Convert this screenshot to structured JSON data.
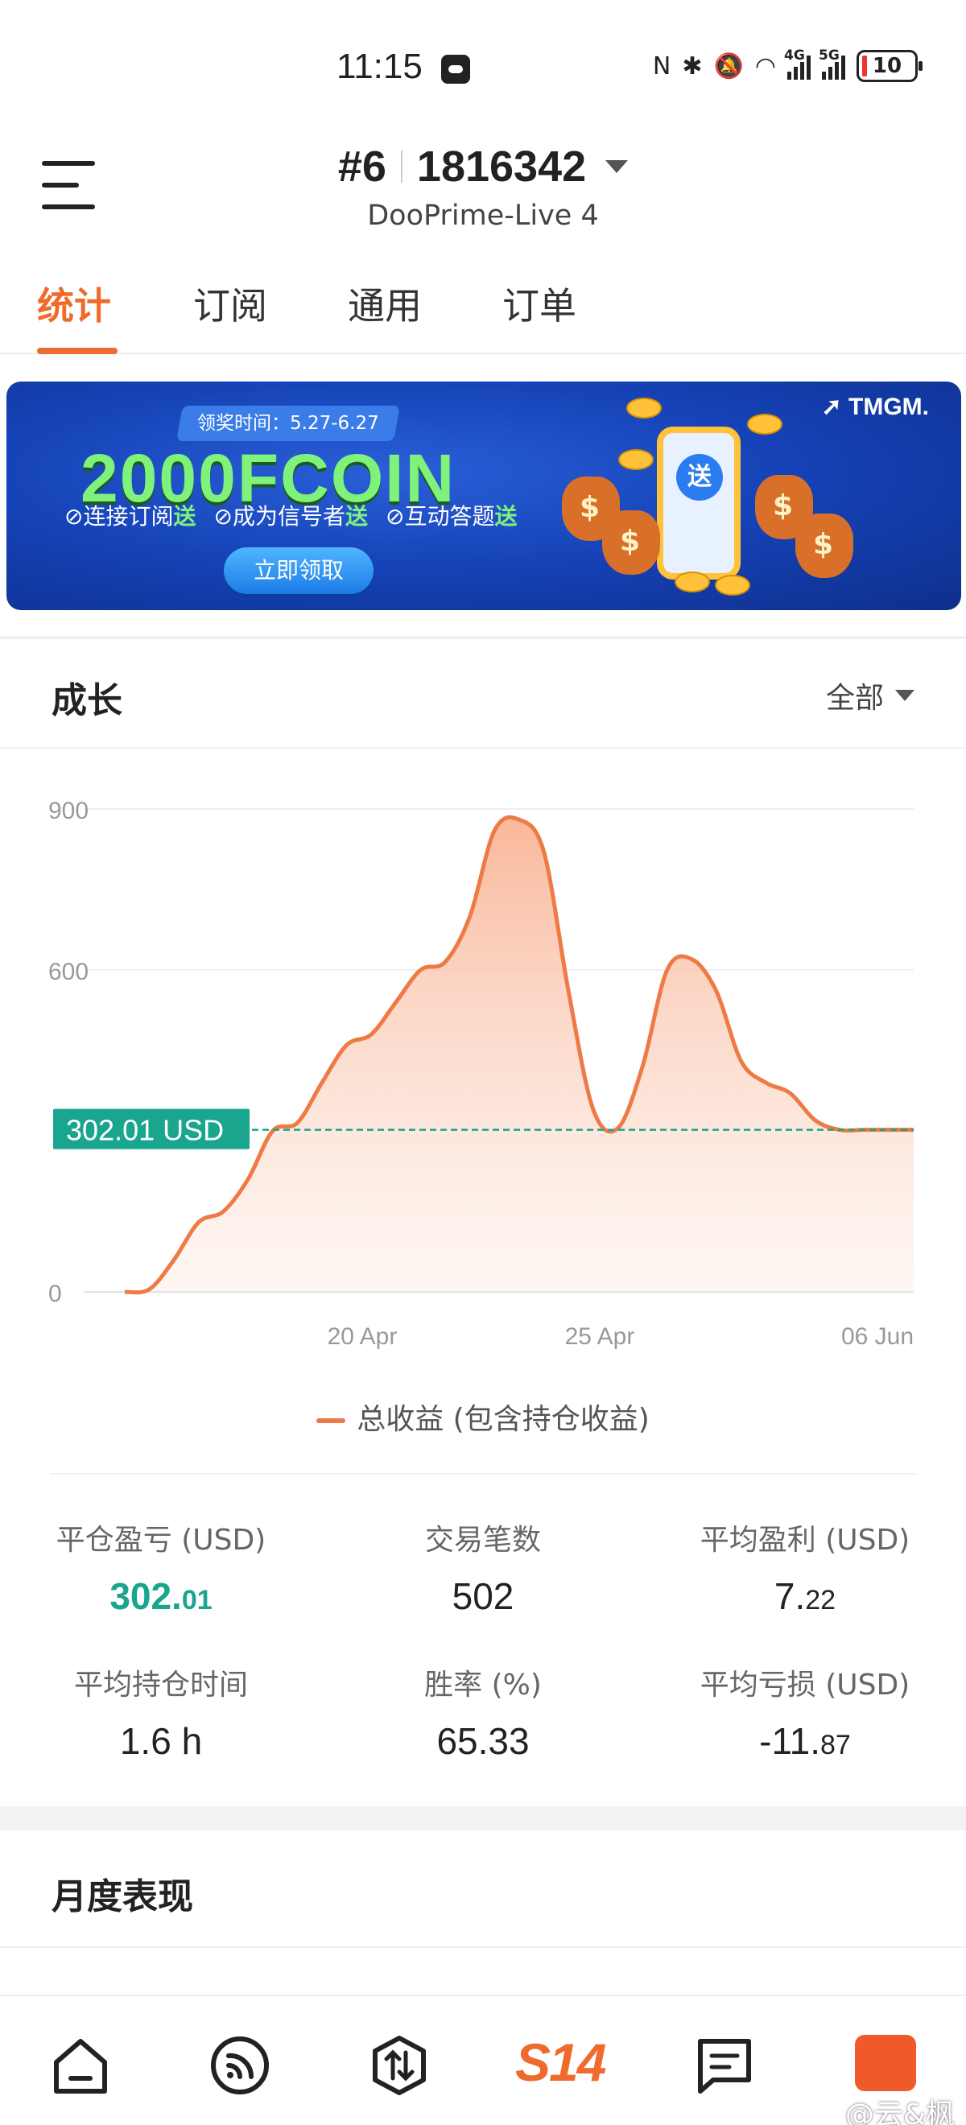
{
  "status_bar": {
    "time": "11:15",
    "net1": "4G",
    "net2": "5G",
    "battery": "10"
  },
  "header": {
    "account_prefix": "#6",
    "account_number": "1816342",
    "server": "DooPrime-Live 4"
  },
  "tabs": [
    {
      "label": "统计",
      "active": true
    },
    {
      "label": "订阅",
      "active": false
    },
    {
      "label": "通用",
      "active": false
    },
    {
      "label": "订单",
      "active": false
    }
  ],
  "banner": {
    "pill": "领奖时间：5.27-6.27",
    "title": "2000FCOIN",
    "perks": [
      {
        "text": "连接订阅",
        "hl": "送"
      },
      {
        "text": "成为信号者",
        "hl": "送"
      },
      {
        "text": "互动答题",
        "hl": "送"
      }
    ],
    "button": "立即领取",
    "brand": "TMGM.",
    "phone_badge": "送"
  },
  "growth": {
    "title": "成长",
    "filter": "全部"
  },
  "chart_data": {
    "type": "area",
    "series": [
      {
        "name": "总收益 (包含持仓收益)",
        "values": [
          0,
          5,
          60,
          130,
          150,
          210,
          300,
          315,
          390,
          460,
          480,
          540,
          600,
          615,
          700,
          860,
          880,
          820,
          560,
          340,
          305,
          420,
          600,
          620,
          560,
          430,
          390,
          370,
          320,
          302,
          302,
          302,
          302
        ]
      }
    ],
    "xtick_labels": [
      "20 Apr",
      "25 Apr",
      "06 Jun"
    ],
    "ytick_labels": [
      "0",
      "600",
      "900"
    ],
    "ylim": [
      0,
      900
    ],
    "current_value_label": "302.01 USD",
    "current_value": 302.01,
    "color": "#ee7a45",
    "marker_color": "#1aa58e",
    "legend": "总收益 (包含持仓收益)"
  },
  "stats": [
    {
      "label": "平仓盈亏 (USD)",
      "int": "302.",
      "dec": "01",
      "green": true
    },
    {
      "label": "交易笔数",
      "int": "502",
      "dec": "",
      "green": false
    },
    {
      "label": "平均盈利 (USD)",
      "int": "7.",
      "dec": "22",
      "green": false
    },
    {
      "label": "平均持仓时间",
      "int": "1.6 h",
      "dec": "",
      "green": false
    },
    {
      "label": "胜率 (%)",
      "int": "65.33",
      "dec": "",
      "green": false
    },
    {
      "label": "平均亏损 (USD)",
      "int": "-11.",
      "dec": "87",
      "green": false
    }
  ],
  "monthly": {
    "title": "月度表现"
  },
  "bottom_nav": {
    "center_label": "S14",
    "watermark": "@云&枫"
  }
}
